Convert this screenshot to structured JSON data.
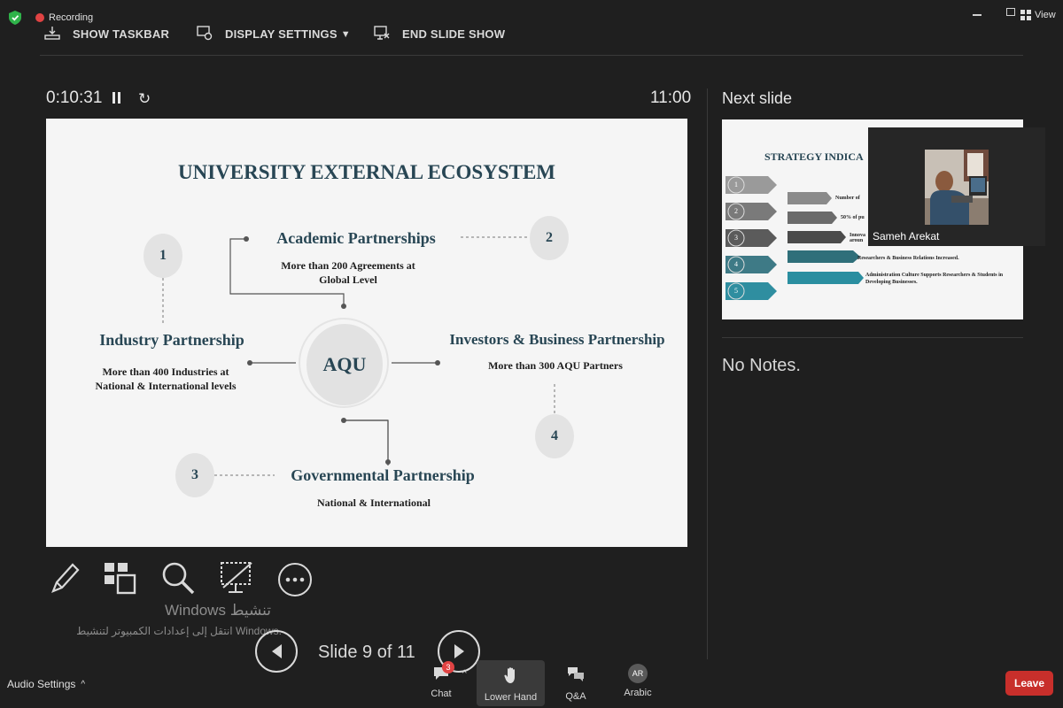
{
  "topbar": {
    "recording_label": "Recording",
    "show_taskbar": "SHOW TASKBAR",
    "display_settings": "DISPLAY SETTINGS",
    "end_slide_show": "END SLIDE SHOW",
    "view_label": "View"
  },
  "presenter": {
    "elapsed_time": "0:10:31",
    "clock": "11:00",
    "next_slide_label": "Next slide",
    "notes": "No Notes.",
    "slide_counter": "Slide 9 of 11"
  },
  "slide": {
    "title": "UNIVERSITY EXTERNAL ECOSYSTEM",
    "center": "AQU",
    "academic": {
      "title": "Academic Partnerships",
      "text": "More than 200 Agreements at Global Level",
      "num": "2"
    },
    "industry": {
      "title": "Industry Partnership",
      "text": "More than 400 Industries at National & International levels",
      "num": "1"
    },
    "investors": {
      "title": "Investors & Business Partnership",
      "text": "More than 300 AQU Partners",
      "num": "4"
    },
    "government": {
      "title": "Governmental Partnership",
      "text": "National & International",
      "num": "3"
    }
  },
  "next_slide": {
    "title": "STRATEGY INDICA",
    "rows": [
      {
        "num": "1",
        "text": "Number of"
      },
      {
        "num": "2",
        "text": "50% of pu"
      },
      {
        "num": "3",
        "text": "Innova aroun"
      },
      {
        "num": "4",
        "text": "Researchers & Business Relations Increased."
      },
      {
        "num": "5",
        "text": "Administration Culture Supports Researchers & Students in Developing Businesses."
      }
    ]
  },
  "video": {
    "participant_name": "Sameh Arekat"
  },
  "watermark": {
    "line1": "Windows تنشيط",
    "line2": "انتقل إلى إعدادات الكمبيوتر لتنشيط Windows."
  },
  "bottombar": {
    "audio_settings": "Audio Settings",
    "chat": "Chat",
    "chat_badge": "3",
    "lower_hand": "Lower Hand",
    "qa": "Q&A",
    "language_code": "AR",
    "language": "Arabic",
    "leave": "Leave"
  },
  "colors": {
    "background": "#1f1f1f",
    "slide_teal": "#284654",
    "leave_red": "#c82f2b",
    "shield_green": "#2fb34a"
  }
}
